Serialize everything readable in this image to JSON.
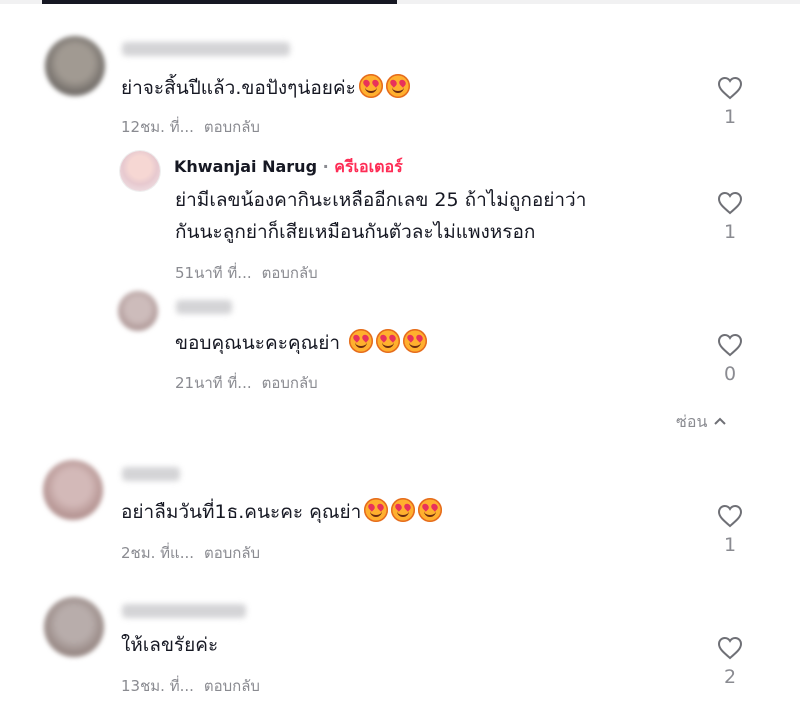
{
  "tabs": {
    "active_index": 0
  },
  "actions": {
    "hide_label": "ซ่อน"
  },
  "comments": [
    {
      "text": "ย่าจะสิ้นปีแล้ว.ขอปังๆน่อยค่ะ",
      "emoji_count": 2,
      "time": "12ชม. ที่...",
      "reply_label": "ตอบกลับ",
      "likes": "1",
      "avatar_color": "#8c8a86",
      "replies": [
        {
          "author": "Khwanjai Narug",
          "separator": " · ",
          "badge": "ครีเอเตอร์",
          "text_line1": "ย่ามีเลขน้องคากินะเหลืออีกเลข 25 ถ้าไม่ถูกอย่าว่า",
          "text_line2": "กันนะลูกย่าก็เสียเหมือนกันตัวละไม่แพงหรอก",
          "time": "51นาที ที่...",
          "reply_label": "ตอบกลับ",
          "likes": "1"
        },
        {
          "text": "ขอบคุณนะคะคุณย่า",
          "emoji_count": 3,
          "time": "21นาที ที่...",
          "reply_label": "ตอบกลับ",
          "likes": "0",
          "avatar_color": "#b9a7a6"
        }
      ]
    },
    {
      "text": "อย่าลืมวันที่1ธ.คนะคะ คุณย่า",
      "emoji_count": 3,
      "time": "2ชม. ที่แ...",
      "reply_label": "ตอบกลับ",
      "likes": "1",
      "avatar_color": "#b99a98"
    },
    {
      "text": "ให้เลขรัยค่ะ",
      "emoji_count": 0,
      "time": "13ชม. ที่...",
      "reply_label": "ตอบกลับ",
      "likes": "2",
      "avatar_color": "#a39a97"
    }
  ],
  "colors": {
    "creator_badge": "#fe2c55",
    "muted": "#8a8b91",
    "text": "#161823"
  }
}
